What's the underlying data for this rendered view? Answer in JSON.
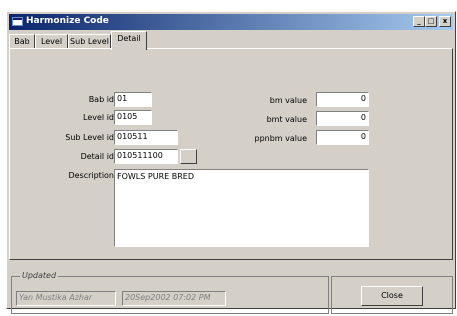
{
  "window": {
    "title": "Harmonize Code",
    "controls": [
      "_",
      "□",
      "x"
    ]
  },
  "tabs": [
    {
      "label": "Bab",
      "active": false
    },
    {
      "label": "Level",
      "active": false
    },
    {
      "label": "Sub Level",
      "active": false
    },
    {
      "label": "Detail",
      "active": true
    }
  ],
  "form": {
    "bab_id": {
      "label": "Bab id",
      "value": "01"
    },
    "level_id": {
      "label": "Level id",
      "value": "0105"
    },
    "sub_level_id": {
      "label": "Sub Level id",
      "value": "010511"
    },
    "detail_id": {
      "label": "Detail id",
      "value": "010511100"
    },
    "description": {
      "label": "Description",
      "value": "FOWLS PURE BRED"
    },
    "bm_value": {
      "label": "bm value",
      "value": "0"
    },
    "bmt_value": {
      "label": "bmt value",
      "value": "0"
    },
    "ppnbm_value": {
      "label": "ppnbm value",
      "value": "0"
    }
  },
  "updated": {
    "title": "Updated",
    "user": "Yan Mustika Azhar",
    "timestamp": "20Sep2002 07:02 PM"
  },
  "close_label": "Close"
}
